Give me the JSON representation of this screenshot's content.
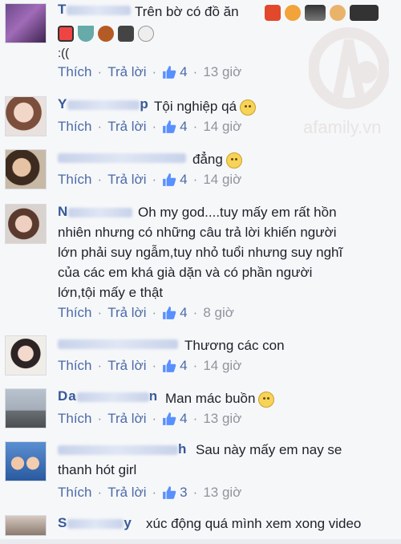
{
  "actions": {
    "like": "Thích",
    "reply": "Trả lời",
    "dot": "·"
  },
  "watermark": {
    "text": "afamily.vn"
  },
  "comments": [
    {
      "name_prefix": "T",
      "text": "Trên bờ có đồ ăn",
      "extra_line": ":((",
      "likes": "4",
      "time": "13 giờ",
      "icons": [
        "fries-icon",
        "bread-icon",
        "noodles-icon",
        "burger-icon",
        "shaved-ice-icon",
        "sushi-icon",
        "soup-icon",
        "cookie-icon",
        "bento-icon",
        "rice-ball-icon"
      ]
    },
    {
      "name_prefix": "Y",
      "name_suffix": "p",
      "text": "Tội nghiệp qá",
      "emoji": "sad-face-icon",
      "likes": "4",
      "time": "14 giờ"
    },
    {
      "name_prefix": "",
      "text": "đẳng",
      "emoji": "frown-face-icon",
      "likes": "4",
      "time": "14 giờ"
    },
    {
      "name_prefix": "N",
      "lines": [
        "Oh my god....tuy mấy em rất hồn",
        "nhiên nhưng có những câu trả lời khiến người",
        "lớn phải suy ngẫm,tuy nhỏ tuổi nhưng suy nghĩ",
        "của các em khá già dặn và có phần người",
        "lớn,tội mấy e thật"
      ],
      "likes": "4",
      "time": "8 giờ"
    },
    {
      "name_prefix": "",
      "text": "Thương các con",
      "likes": "4",
      "time": "14 giờ"
    },
    {
      "name_prefix": "Da",
      "name_suffix": "n",
      "text": "Man mác buồn",
      "emoji": "crying-face-icon",
      "likes": "4",
      "time": "13 giờ"
    },
    {
      "name_prefix": "",
      "name_suffix": "h",
      "lines": [
        "Sau này mấy em nay se",
        "thanh hót girl"
      ],
      "likes": "3",
      "time": "13 giờ"
    },
    {
      "name_prefix": "S",
      "name_suffix": "y",
      "text": "xúc động quá mình xem xong video"
    }
  ]
}
